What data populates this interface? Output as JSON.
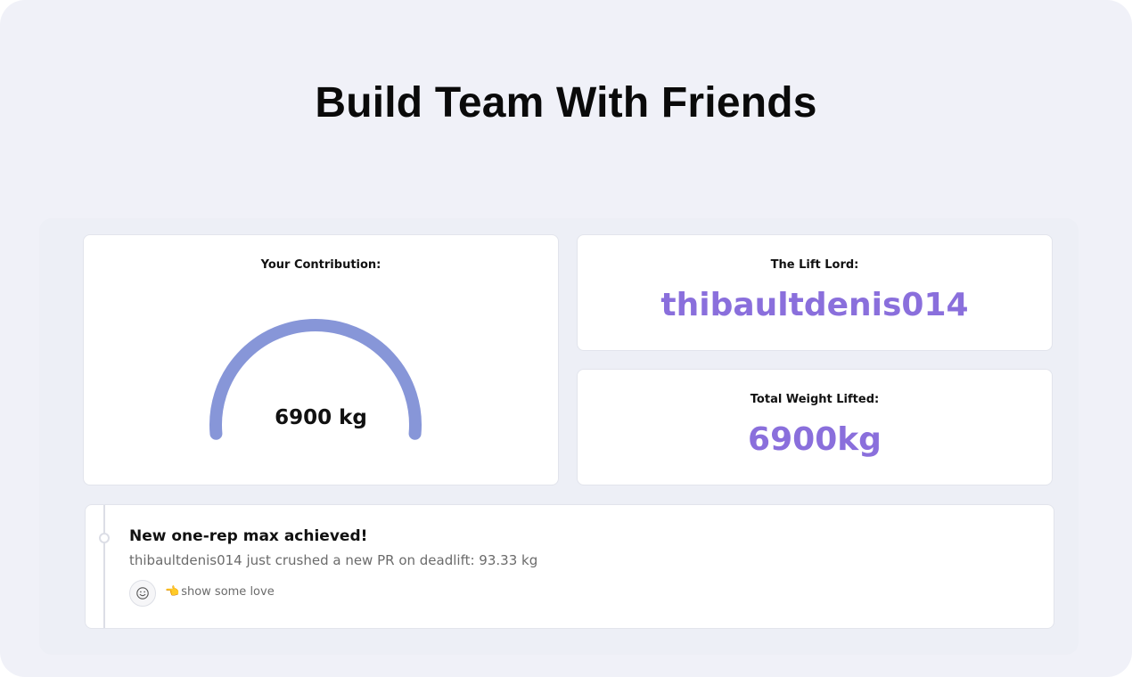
{
  "page": {
    "title": "Build Team With Friends"
  },
  "contribution": {
    "label": "Your Contribution:",
    "value_text": "6900 kg",
    "gauge_fraction": 1.0,
    "gauge_color": "#8796d8"
  },
  "lift_lord": {
    "label": "The Lift Lord:",
    "username": "thibaultdenis014"
  },
  "total_weight": {
    "label": "Total Weight Lifted:",
    "value": "6900kg"
  },
  "feed": {
    "items": [
      {
        "title": "New one-rep max achieved!",
        "description": "thibaultdenis014 just crushed a new PR on deadlift: 93.33 kg",
        "reaction_icon": "smiley-icon",
        "love_emoji": "👈",
        "love_label": "show some love"
      }
    ]
  },
  "colors": {
    "accent": "#8a6fdc",
    "gauge": "#8796d8",
    "background": "#f0f1f8"
  }
}
